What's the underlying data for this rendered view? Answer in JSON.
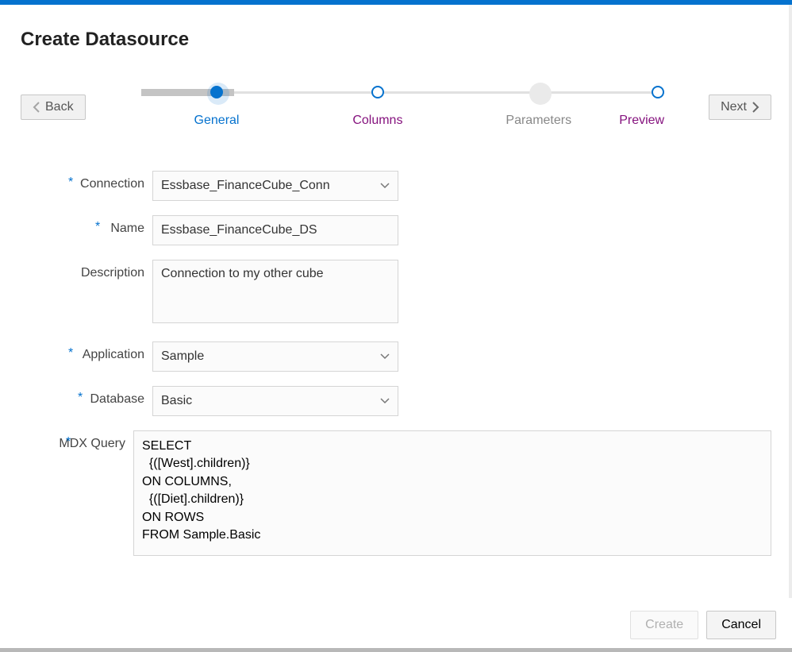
{
  "header": {
    "title": "Create Datasource"
  },
  "nav": {
    "back": "Back",
    "next": "Next"
  },
  "steps": {
    "s1": "General",
    "s2": "Columns",
    "s3": "Parameters",
    "s4": "Preview"
  },
  "form": {
    "connection": {
      "label": "Connection",
      "value": "Essbase_FinanceCube_Conn"
    },
    "name": {
      "label": "Name",
      "value": "Essbase_FinanceCube_DS"
    },
    "description": {
      "label": "Description",
      "value": "Connection to my other cube"
    },
    "application": {
      "label": "Application",
      "value": "Sample"
    },
    "database": {
      "label": "Database",
      "value": "Basic"
    },
    "mdx": {
      "label": "MDX Query",
      "value": "SELECT\n  {([West].children)}\nON COLUMNS,\n  {([Diet].children)}\nON ROWS\nFROM Sample.Basic"
    }
  },
  "buttons": {
    "create": "Create",
    "cancel": "Cancel"
  }
}
